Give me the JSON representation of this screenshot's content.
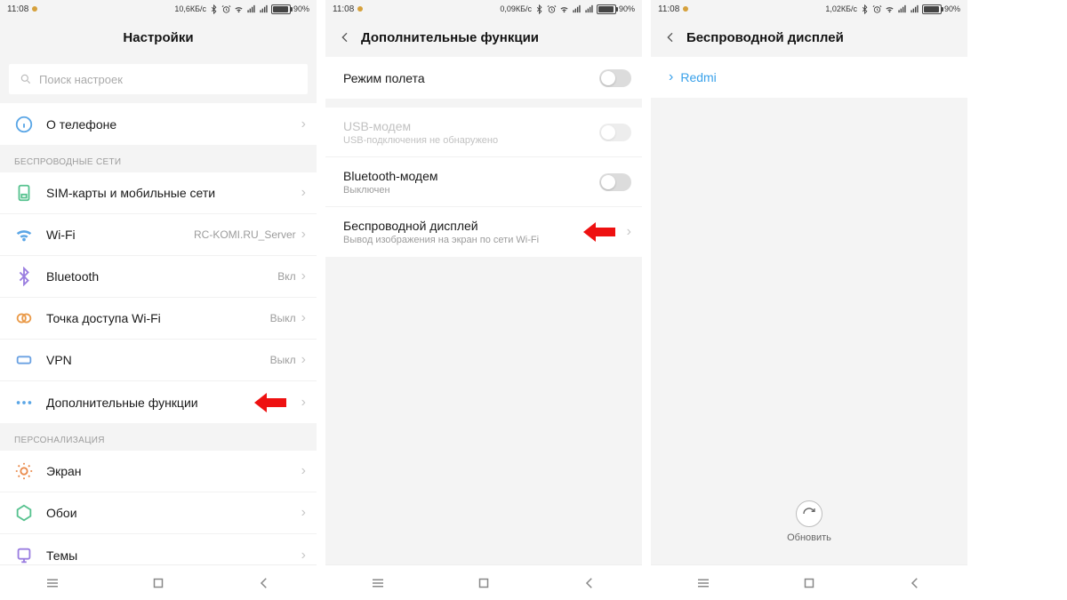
{
  "status": {
    "time": "11:08",
    "net1": "10,6КБ/с",
    "net2": "0,09КБ/с",
    "net3": "1,02КБ/с",
    "battery": "90%"
  },
  "screen1": {
    "title": "Настройки",
    "search_placeholder": "Поиск настроек",
    "about": "О телефоне",
    "sec_wireless": "БЕСПРОВОДНЫЕ СЕТИ",
    "sim": "SIM-карты и мобильные сети",
    "wifi": "Wi-Fi",
    "wifi_val": "RC-KOMI.RU_Server",
    "bt": "Bluetooth",
    "bt_val": "Вкл",
    "hotspot": "Точка доступа Wi-Fi",
    "hotspot_val": "Выкл",
    "vpn": "VPN",
    "vpn_val": "Выкл",
    "more": "Дополнительные функции",
    "sec_personal": "ПЕРСОНАЛИЗАЦИЯ",
    "display": "Экран",
    "wallpaper": "Обои",
    "themes": "Темы"
  },
  "screen2": {
    "title": "Дополнительные функции",
    "airplane": "Режим полета",
    "usb": "USB-модем",
    "usb_sub": "USB-подключения не обнаружено",
    "btm": "Bluetooth-модем",
    "btm_sub": "Выключен",
    "wd": "Беспроводной дисплей",
    "wd_sub": "Вывод изображения на экран по сети Wi-Fi"
  },
  "screen3": {
    "title": "Беспроводной дисплей",
    "device": "Redmi",
    "refresh": "Обновить"
  }
}
